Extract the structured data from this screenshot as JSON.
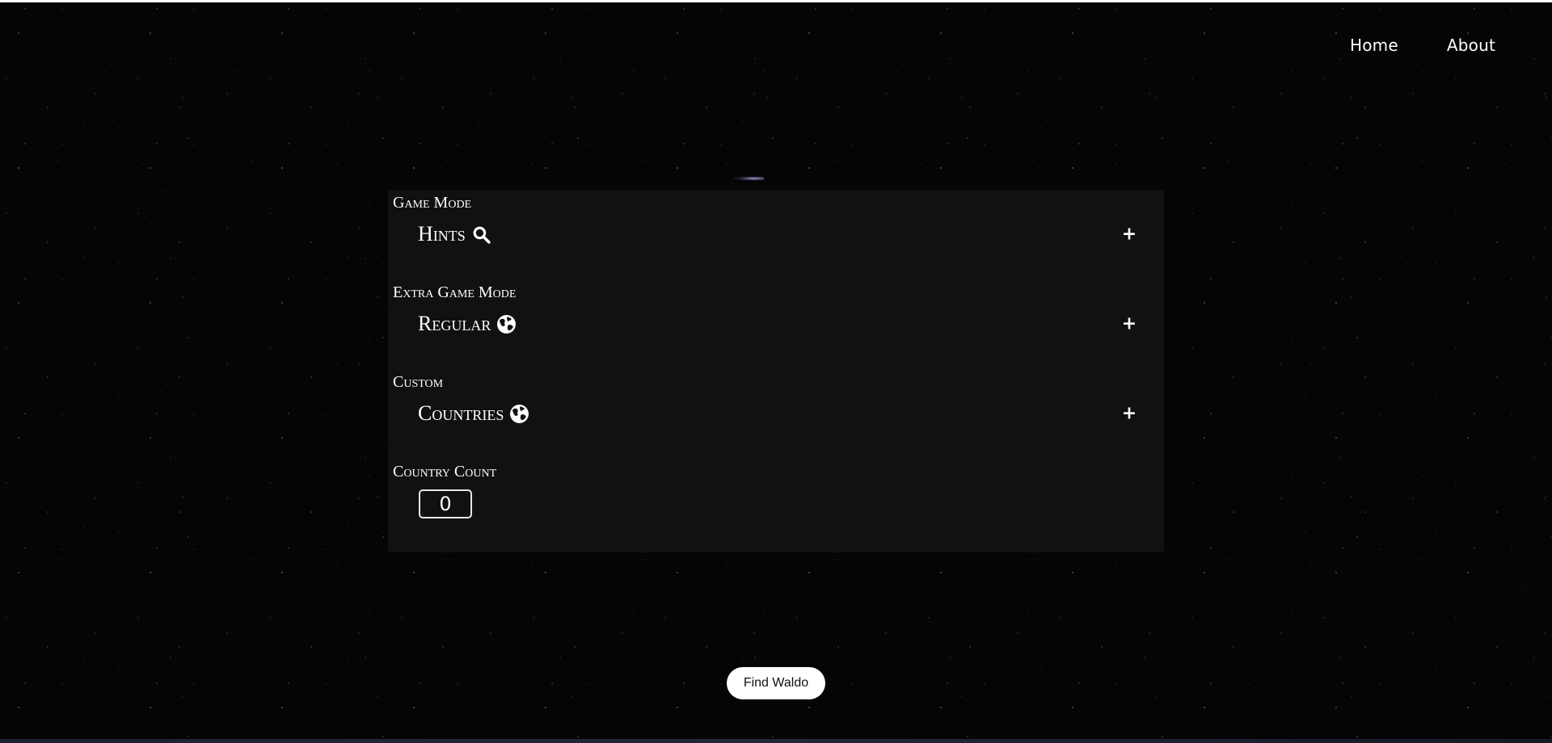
{
  "nav": {
    "home_label": "Home",
    "about_label": "About"
  },
  "panel": {
    "sections": [
      {
        "label": "Game Mode",
        "option": "Hints",
        "icon": "search-icon",
        "action": "+"
      },
      {
        "label": "Extra Game Mode",
        "option": "Regular",
        "icon": "globe-icon",
        "action": "+"
      },
      {
        "label": "Custom",
        "option": "Countries",
        "icon": "globe-icon",
        "action": "+"
      }
    ],
    "count": {
      "label": "Country Count",
      "value": "0"
    }
  },
  "actions": {
    "find_label": "Find Waldo"
  },
  "colors": {
    "background": "#050505",
    "panel": "#111111",
    "text": "#ffffff",
    "button_bg": "#ffffff",
    "button_text": "#111111"
  }
}
